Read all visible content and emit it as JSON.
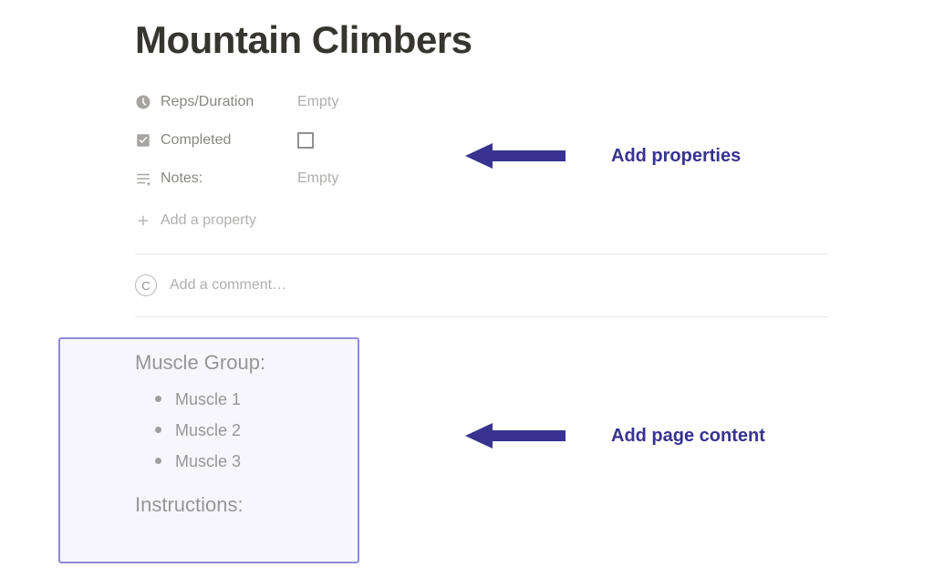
{
  "page": {
    "title": "Mountain Climbers"
  },
  "properties": {
    "reps": {
      "label": "Reps/Duration",
      "value": "Empty"
    },
    "completed": {
      "label": "Completed",
      "checked": false
    },
    "notes": {
      "label": "Notes:",
      "value": "Empty"
    },
    "add_label": "Add a property"
  },
  "comment": {
    "avatar_initial": "C",
    "placeholder": "Add a comment…"
  },
  "content": {
    "muscle_group_heading": "Muscle Group:",
    "muscles": [
      "Muscle 1",
      "Muscle 2",
      "Muscle 3"
    ],
    "instructions_heading": "Instructions:"
  },
  "annotations": {
    "properties": "Add properties",
    "content": "Add page content"
  },
  "colors": {
    "annotation": "#37338f",
    "highlight_border": "#8f8ad6"
  }
}
